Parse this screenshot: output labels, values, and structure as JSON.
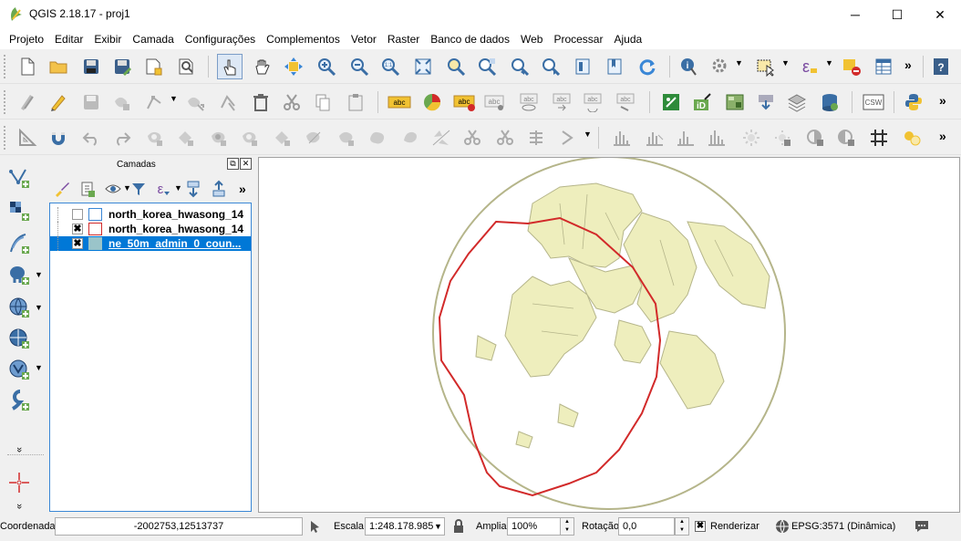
{
  "window": {
    "title": "QGIS 2.18.17 - proj1",
    "min_glyph": "─",
    "max_glyph": "☐",
    "close_glyph": "✕"
  },
  "menu": [
    "Projeto",
    "Editar",
    "Exibir",
    "Camada",
    "Configurações",
    "Complementos",
    "Vetor",
    "Raster",
    "Banco de dados",
    "Web",
    "Processar",
    "Ajuda"
  ],
  "toolbar_icons": {
    "overflow": "»",
    "dropdown": "▼",
    "abc": "abc",
    "csw": "CSW",
    "one_to_one": "1:1",
    "help": "?",
    "epsilon": "ε"
  },
  "layers_panel": {
    "title": "Camadas",
    "float_glyph": "⧉",
    "close_glyph": "✕",
    "overflow": "»",
    "layers": [
      {
        "name": "north_korea_hwasong_14",
        "checked": false,
        "check_glyph": "",
        "symbol_color": "#3a87d6",
        "selected": false
      },
      {
        "name": "north_korea_hwasong_14",
        "checked": true,
        "check_glyph": "✖",
        "symbol_color": "#d22a2a",
        "selected": false
      },
      {
        "name": "ne_50m_admin_0_coun...",
        "checked": true,
        "check_glyph": "✖",
        "symbol_color": "#9ac4c9",
        "selected": true
      }
    ]
  },
  "left_toolbar": {
    "more_glyph": "»"
  },
  "map": {
    "land_color": "#eeeebd",
    "border_color": "#b5b58a",
    "line_color": "#d22a2a"
  },
  "status": {
    "coord_label": "Coordenada",
    "coord_value": "-2002753,12513737",
    "scale_label": "Escala",
    "scale_value": "1:248.178.985",
    "magnifier_label": "Ampliar",
    "magnifier_value": "100%",
    "rotation_label": "Rotação",
    "rotation_value": "0,0",
    "render_label": "Renderizar",
    "render_checked": true,
    "crs_label": "EPSG:3571 (Dinâmica)"
  }
}
